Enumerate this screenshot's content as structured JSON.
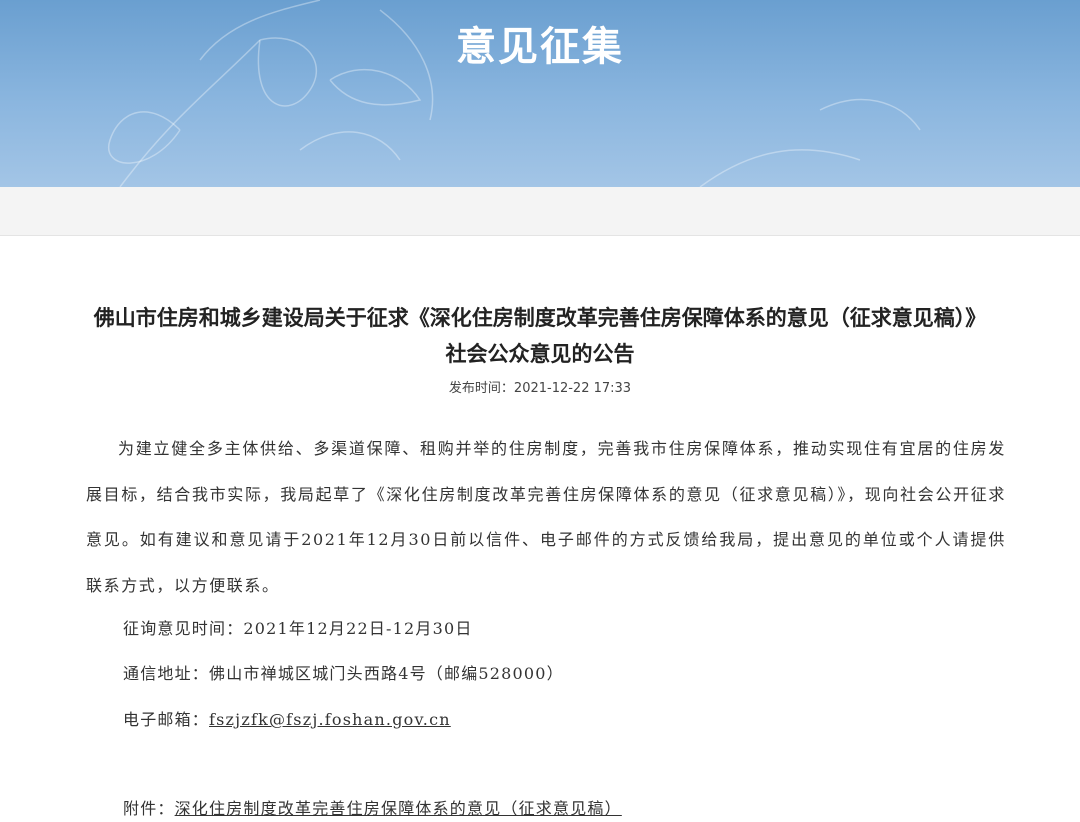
{
  "banner": {
    "title": "意见征集"
  },
  "article": {
    "title": "佛山市住房和城乡建设局关于征求《深化住房制度改革完善住房保障体系的意见（征求意见稿）》社会公众意见的公告",
    "pubtime": "发布时间：2021-12-22 17:33",
    "body": "为建立健全多主体供给、多渠道保障、租购并举的住房制度，完善我市住房保障体系，推动实现住有宜居的住房发展目标，结合我市实际，我局起草了《深化住房制度改革完善住房保障体系的意见（征求意见稿）》，现向社会公开征求意见。如有建议和意见请于2021年12月30日前以信件、电子邮件的方式反馈给我局，提出意见的单位或个人请提供联系方式，以方便联系。",
    "period_label": "征询意见时间：",
    "period_value": "2021年12月22日-12月30日",
    "address_label": "通信地址：",
    "address_value": "佛山市禅城区城门头西路4号（邮编528000）",
    "email_label": "电子邮箱：",
    "email_value": "fszjzfk@fszj.foshan.gov.cn",
    "attachment_label": "附件：",
    "attachment_value": "深化住房制度改革完善住房保障体系的意见（征求意见稿）"
  }
}
